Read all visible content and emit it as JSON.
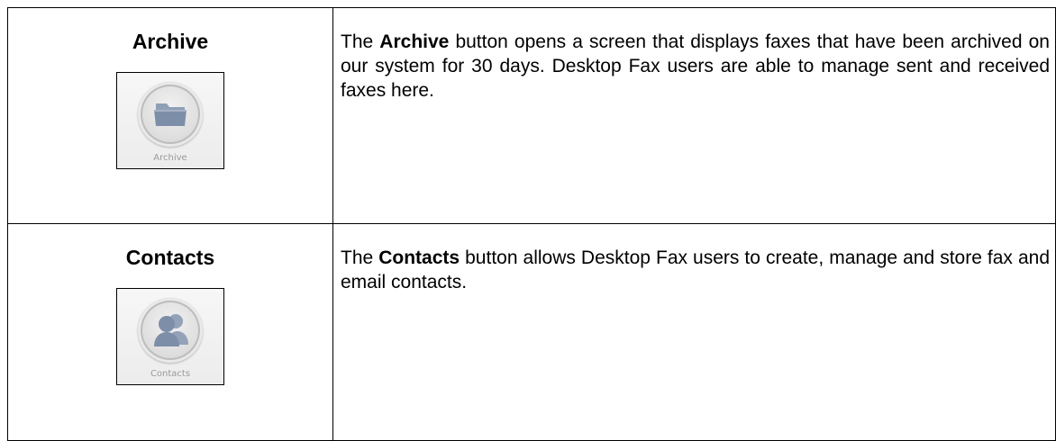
{
  "rows": [
    {
      "name": "Archive",
      "icon_name": "folder-icon",
      "caption": "Archive",
      "desc_prefix": "The ",
      "desc_bold": "Archive",
      "desc_suffix": " button opens a screen that displays faxes that have been archived on our system for 30 days. Desktop Fax users are able to manage sent and received faxes here."
    },
    {
      "name": "Contacts",
      "icon_name": "contacts-icon",
      "caption": "Contacts",
      "desc_prefix": "The ",
      "desc_bold": "Contacts",
      "desc_suffix": " button allows Desktop Fax users to create, manage and store fax and email contacts."
    }
  ],
  "colors": {
    "icon_fill": "#7d8fa8",
    "caption": "#9a9a9a",
    "border": "#000000"
  }
}
